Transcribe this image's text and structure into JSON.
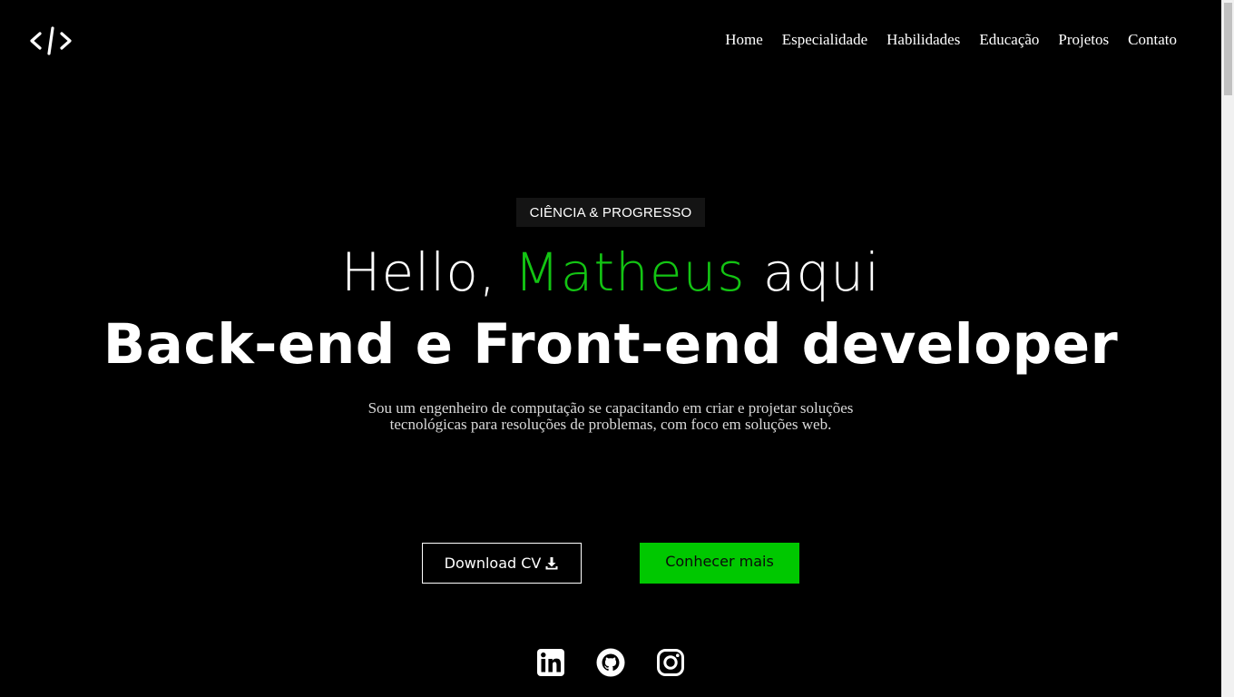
{
  "logo": {
    "icon": "code-slash-icon"
  },
  "nav": {
    "items": [
      {
        "label": "Home"
      },
      {
        "label": "Especialidade"
      },
      {
        "label": "Habilidades"
      },
      {
        "label": "Educação"
      },
      {
        "label": "Projetos"
      },
      {
        "label": "Contato"
      }
    ]
  },
  "hero": {
    "badge": "CIÊNCIA & PROGRESSO",
    "greeting_prefix": "Hello,",
    "greeting_name": "Matheus",
    "greeting_suffix": "aqui",
    "headline": "Back-end e Front-end developer",
    "description": "Sou um engenheiro de computação se capacitando em criar e projetar soluções tecnológicas para resoluções de problemas, com foco em soluções web."
  },
  "buttons": {
    "download_cv": {
      "label": "Download CV",
      "icon": "download-icon"
    },
    "learn_more": {
      "label": "Conhecer mais"
    }
  },
  "socials": [
    {
      "name": "linkedin",
      "icon": "linkedin-icon"
    },
    {
      "name": "github",
      "icon": "github-icon"
    },
    {
      "name": "instagram",
      "icon": "instagram-icon"
    }
  ],
  "colors": {
    "background": "#000000",
    "accent": "#13c413",
    "button_green": "#00c800",
    "badge_bg": "#141414"
  }
}
